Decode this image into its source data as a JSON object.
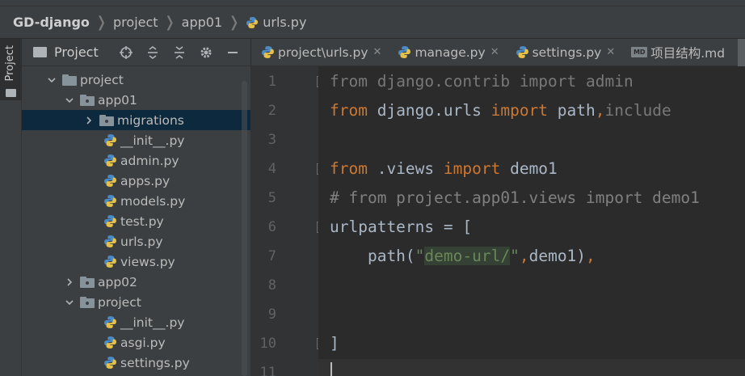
{
  "breadcrumb": {
    "project_root": "GD-django",
    "folder1": "project",
    "folder2": "app01",
    "file": "urls.py"
  },
  "toolwindow_strip": {
    "label": "Project"
  },
  "project_panel": {
    "title": "Project"
  },
  "tree": [
    {
      "label": "project",
      "type": "folder",
      "expanded": true
    },
    {
      "label": "app01",
      "type": "package",
      "expanded": true
    },
    {
      "label": "migrations",
      "type": "folder",
      "expanded": false,
      "selected": true
    },
    {
      "label": "__init__.py",
      "type": "python"
    },
    {
      "label": "admin.py",
      "type": "python"
    },
    {
      "label": "apps.py",
      "type": "python"
    },
    {
      "label": "models.py",
      "type": "python"
    },
    {
      "label": "test.py",
      "type": "python"
    },
    {
      "label": "urls.py",
      "type": "python"
    },
    {
      "label": "views.py",
      "type": "python"
    },
    {
      "label": "app02",
      "type": "package",
      "expanded": false
    },
    {
      "label": "project",
      "type": "package",
      "expanded": true
    },
    {
      "label": "__init__.py",
      "type": "python"
    },
    {
      "label": "asgi.py",
      "type": "python"
    },
    {
      "label": "settings.py",
      "type": "python"
    }
  ],
  "tabs": [
    {
      "label": "project\\urls.py",
      "icon": "python-file-icon",
      "active": true
    },
    {
      "label": "manage.py",
      "icon": "python-file-icon"
    },
    {
      "label": "settings.py",
      "icon": "python-file-icon"
    },
    {
      "label": "项目结构.md",
      "icon": "markdown-file-icon"
    }
  ],
  "md_badge": "MD",
  "code": {
    "line_numbers": [
      "1",
      "2",
      "3",
      "4",
      "5",
      "6",
      "7",
      "8",
      "9",
      "10",
      "11"
    ],
    "l1": {
      "a": "from",
      "b": " django.contrib ",
      "c": "import",
      "d": " admin"
    },
    "l2": {
      "a": "from",
      "b": " django.urls ",
      "c": "import",
      "d": " path",
      "e": ",",
      "f": "include"
    },
    "l4": {
      "a": "from",
      "b": " .views ",
      "c": "import",
      "d": " demo1"
    },
    "l5": "# from project.app01.views import demo1",
    "l6": "urlpatterns = [",
    "l7": {
      "a": "    path(",
      "b": "\"",
      "c": "demo-url/",
      "d": "\"",
      "e": ",",
      "f": "demo1)",
      "g": ","
    },
    "l10": "]"
  },
  "colors": {
    "keyword": "#cc7832",
    "string": "#6a8759",
    "comment": "#808080",
    "text": "#a9b7c6",
    "selection": "#0d293e"
  }
}
